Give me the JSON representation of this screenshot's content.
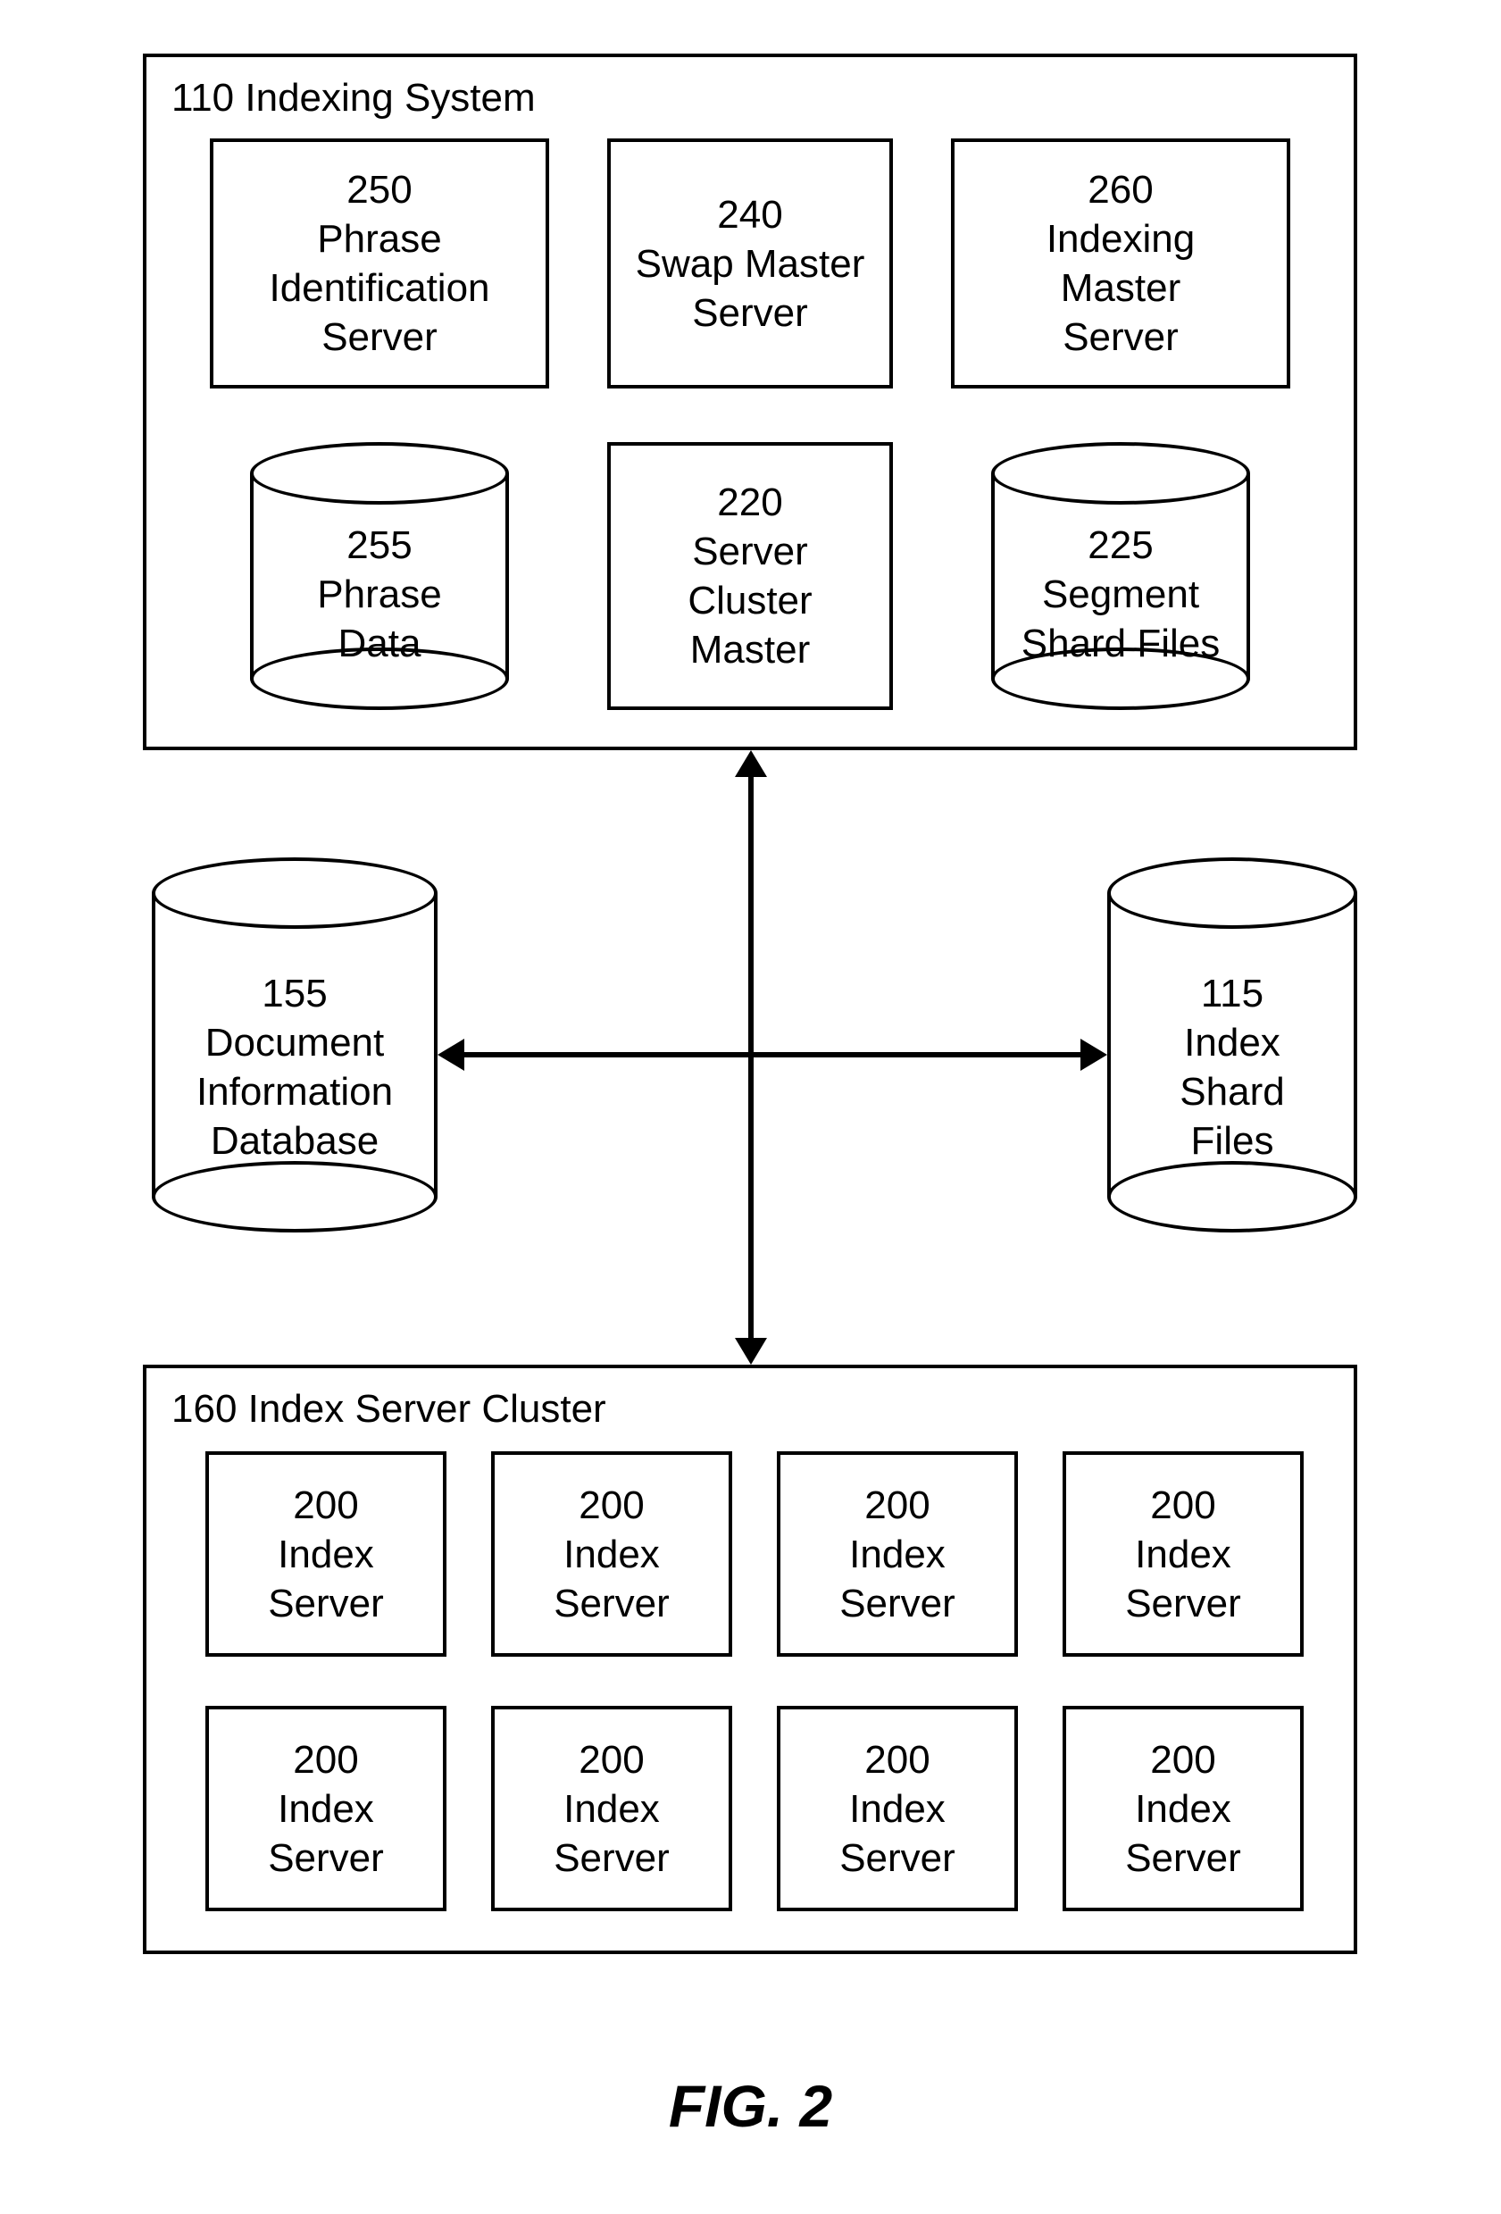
{
  "figure_caption": "FIG. 2",
  "groups": {
    "indexing_system": {
      "id": "110",
      "title": "110 Indexing System"
    },
    "index_server_cluster": {
      "id": "160",
      "title": "160 Index Server Cluster"
    }
  },
  "boxes": {
    "phrase_id_server": {
      "id": "250",
      "lines": [
        "250",
        "Phrase",
        "Identification",
        "Server"
      ]
    },
    "swap_master": {
      "id": "240",
      "lines": [
        "240",
        "Swap Master",
        "Server"
      ]
    },
    "indexing_master": {
      "id": "260",
      "lines": [
        "260",
        "Indexing",
        "Master",
        "Server"
      ]
    },
    "server_cluster_master": {
      "id": "220",
      "lines": [
        "220",
        "Server",
        "Cluster",
        "Master"
      ]
    }
  },
  "cylinders": {
    "phrase_data": {
      "id": "255",
      "lines": [
        "255",
        "Phrase",
        "Data"
      ]
    },
    "segment_shard": {
      "id": "225",
      "lines": [
        "225",
        "Segment",
        "Shard Files"
      ]
    },
    "doc_info_db": {
      "id": "155",
      "lines": [
        "155",
        "Document",
        "Information",
        "Database"
      ]
    },
    "index_shard_files": {
      "id": "115",
      "lines": [
        "115",
        "Index",
        "Shard",
        "Files"
      ]
    }
  },
  "index_servers": [
    {
      "id": "200",
      "lines": [
        "200",
        "Index",
        "Server"
      ]
    },
    {
      "id": "200",
      "lines": [
        "200",
        "Index",
        "Server"
      ]
    },
    {
      "id": "200",
      "lines": [
        "200",
        "Index",
        "Server"
      ]
    },
    {
      "id": "200",
      "lines": [
        "200",
        "Index",
        "Server"
      ]
    },
    {
      "id": "200",
      "lines": [
        "200",
        "Index",
        "Server"
      ]
    },
    {
      "id": "200",
      "lines": [
        "200",
        "Index",
        "Server"
      ]
    },
    {
      "id": "200",
      "lines": [
        "200",
        "Index",
        "Server"
      ]
    },
    {
      "id": "200",
      "lines": [
        "200",
        "Index",
        "Server"
      ]
    }
  ]
}
